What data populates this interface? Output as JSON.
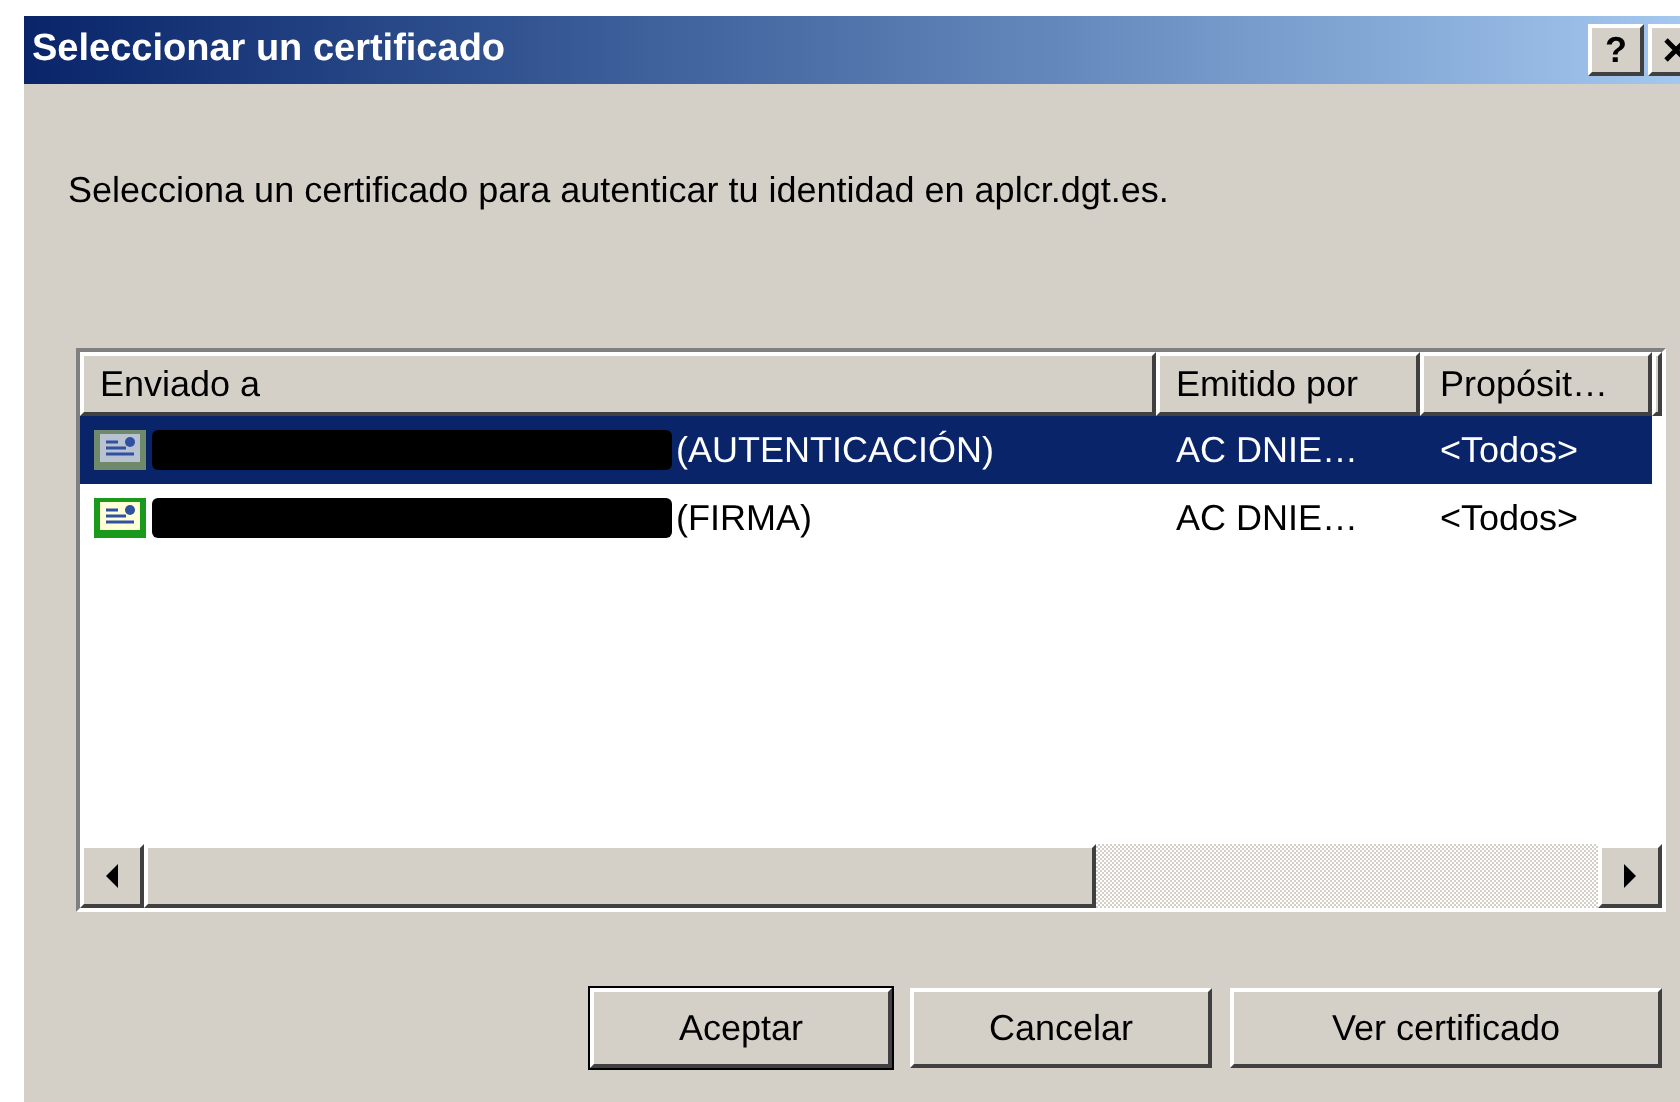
{
  "window": {
    "title": "Seleccionar un certificado",
    "help_button": "?"
  },
  "prompt": "Selecciona un certificado para autenticar tu identidad en aplcr.dgt.es.",
  "table": {
    "columns": [
      "Enviado a",
      "Emitido por",
      "Propósit…"
    ],
    "rows": [
      {
        "sent_to": "(AUTENTICACIÓN)",
        "issued_by": "AC DNIE…",
        "purpose": "<Todos>",
        "selected": true
      },
      {
        "sent_to": "(FIRMA)",
        "issued_by": "AC DNIE…",
        "purpose": "<Todos>",
        "selected": false
      }
    ]
  },
  "buttons": [
    {
      "label": "Aceptar",
      "default": true
    },
    {
      "label": "Cancelar",
      "default": false
    },
    {
      "label": "Ver certificado",
      "default": false
    }
  ]
}
